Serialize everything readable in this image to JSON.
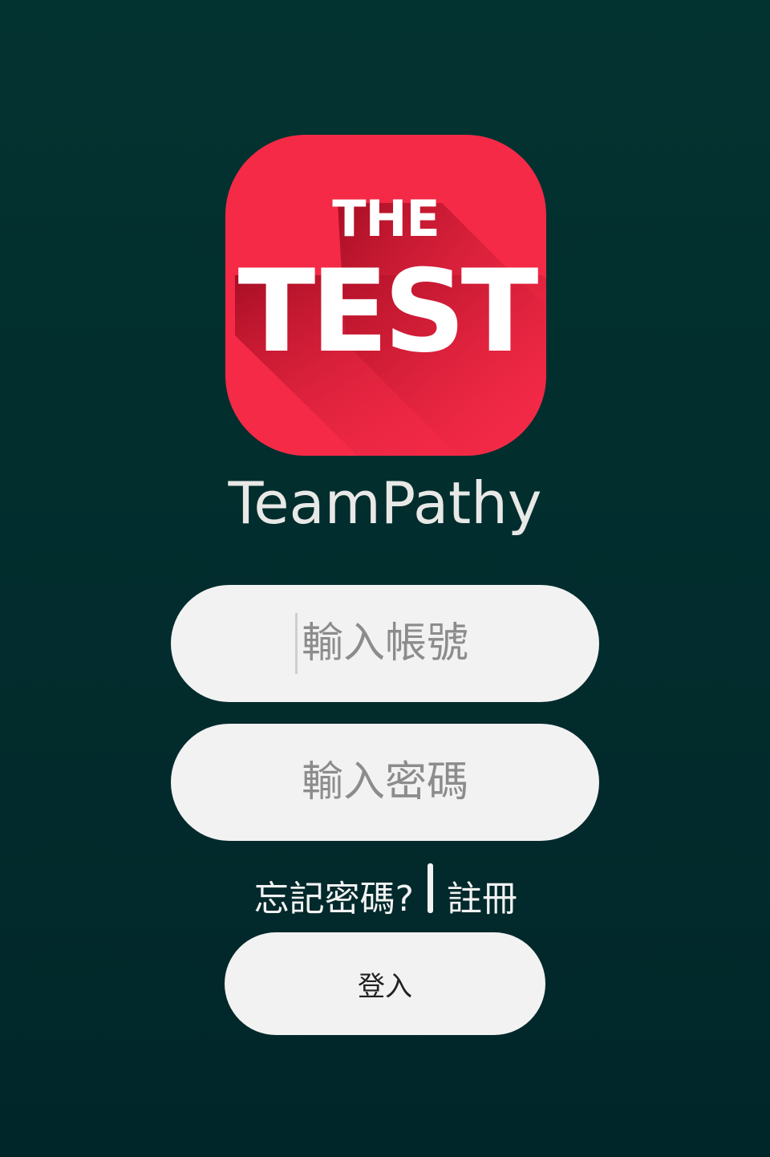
{
  "logo": {
    "line1": "THE",
    "line2": "TEST",
    "background_color": "#f42a47",
    "shadow_color": "#b7132a"
  },
  "app": {
    "name": "TeamPathy"
  },
  "login_form": {
    "username_placeholder": "輸入帳號",
    "username_value": "",
    "password_placeholder": "輸入密碼",
    "password_value": "",
    "forgot_password_label": "忘記密碼?",
    "register_label": "註冊",
    "login_button_label": "登入"
  },
  "colors": {
    "background": "#02302f",
    "field_background": "#f2f2f2",
    "placeholder": "#8c8c8c"
  }
}
